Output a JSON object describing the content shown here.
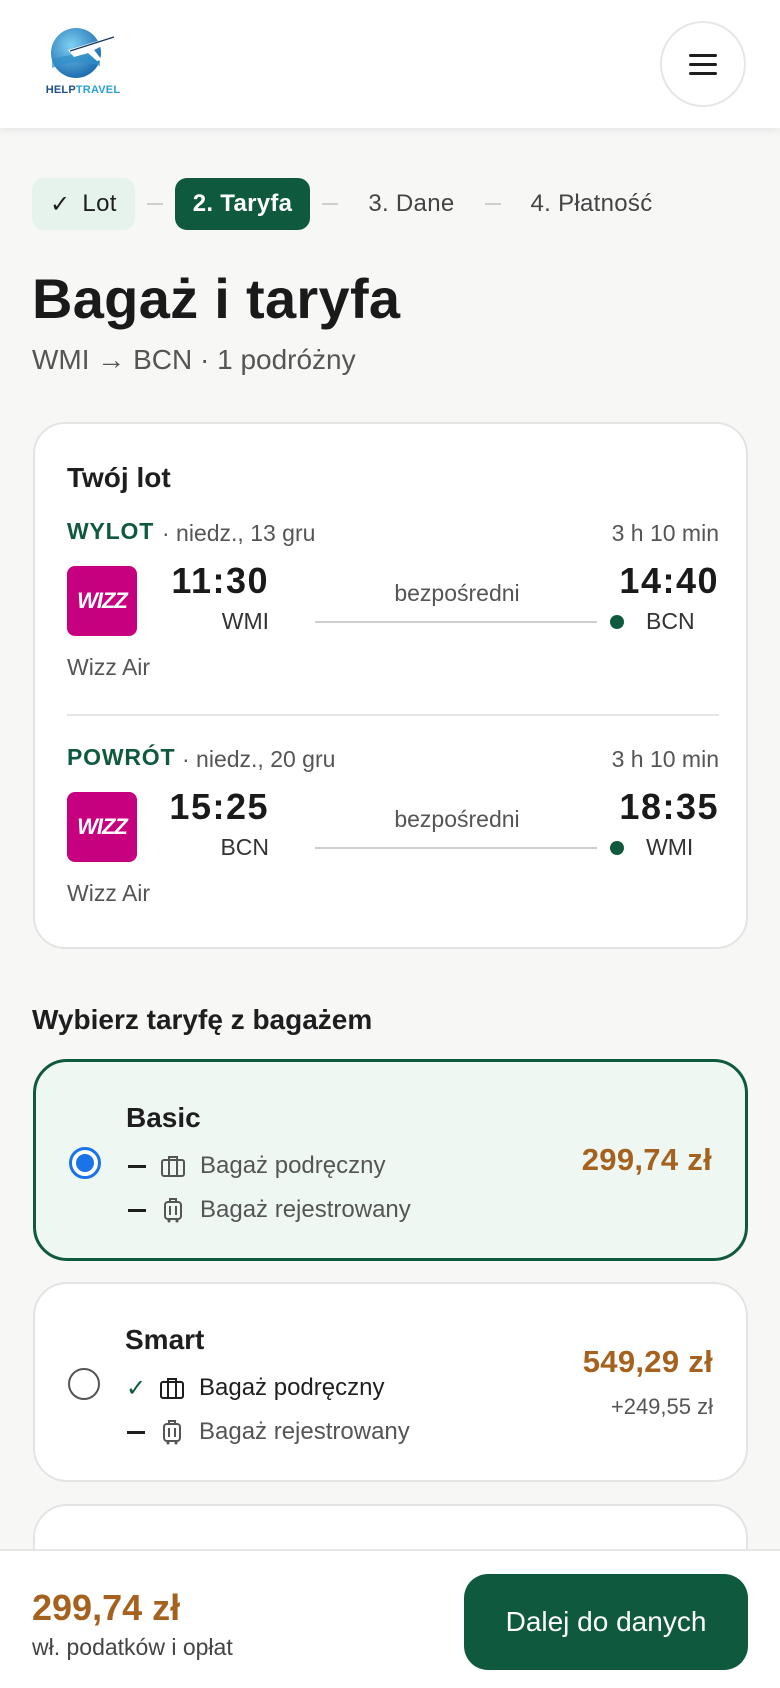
{
  "header": {
    "logo_text_1": "HELP",
    "logo_text_2": "TRAVEL",
    "menu_icon": "hamburger-menu-icon"
  },
  "stepper": {
    "steps": [
      {
        "label": "Lot",
        "state": "done"
      },
      {
        "label": "2. Taryfa",
        "state": "active"
      },
      {
        "label": "3. Dane",
        "state": "upcoming"
      },
      {
        "label": "4. Płatność",
        "state": "upcoming"
      }
    ]
  },
  "page": {
    "title": "Bagaż i taryfa",
    "subtitle": "WMI → BCN · 1 podróżny"
  },
  "flight_card": {
    "title": "Twój lot",
    "legs": [
      {
        "label": "WYLOT",
        "date": "· niedz., 13 gru",
        "duration": "3 h 10 min",
        "airline_logo": "WIZZ",
        "dep_time": "11:30",
        "dep_code": "WMI",
        "stops": "bezpośredni",
        "arr_time": "14:40",
        "arr_code": "BCN",
        "airline": "Wizz Air"
      },
      {
        "label": "POWRÓT",
        "date": "· niedz., 20 gru",
        "duration": "3 h 10 min",
        "airline_logo": "WIZZ",
        "dep_time": "15:25",
        "dep_code": "BCN",
        "stops": "bezpośredni",
        "arr_time": "18:35",
        "arr_code": "WMI",
        "airline": "Wizz Air"
      }
    ]
  },
  "fares": {
    "section_title": "Wybierz taryfę z bagażem",
    "items": [
      {
        "name": "Basic",
        "selected": true,
        "price": "299,74 zł",
        "diff": "",
        "features": [
          {
            "label": "Bagaż podręczny",
            "included": false,
            "icon": "cabin-bag-icon"
          },
          {
            "label": "Bagaż rejestrowany",
            "included": false,
            "icon": "checked-suitcase-icon"
          }
        ]
      },
      {
        "name": "Smart",
        "selected": false,
        "price": "549,29 zł",
        "diff": "+249,55 zł",
        "features": [
          {
            "label": "Bagaż podręczny",
            "included": true,
            "icon": "cabin-bag-icon"
          },
          {
            "label": "Bagaż rejestrowany",
            "included": false,
            "icon": "checked-suitcase-icon"
          }
        ]
      }
    ]
  },
  "bottom_bar": {
    "total": "299,74 zł",
    "note": "wł. podatków i opłat",
    "next_label": "Dalej do danych"
  },
  "colors": {
    "brand_green": "#0f5a3e",
    "price_brown": "#a5621e",
    "radio_blue": "#1a73e8",
    "wizz_magenta": "#c6007e"
  }
}
